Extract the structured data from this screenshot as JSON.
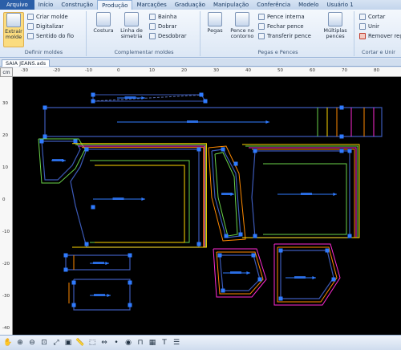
{
  "tabs": [
    "Arquivo",
    "Início",
    "Construção",
    "Produção",
    "Marcações",
    "Graduação",
    "Manipulação",
    "Conferência",
    "Modelo",
    "Usuário 1"
  ],
  "active_tab": "Produção",
  "ribbon": {
    "definir_moldes": {
      "label": "Definir moldes",
      "extrair": "Extrair\nmolde",
      "criar": "Criar molde",
      "digitalizar": "Digitalizar",
      "sentido": "Sentido do fio"
    },
    "complementar": {
      "label": "Complementar moldes",
      "costura": "Costura",
      "linha": "Linha de\nsimetria",
      "bainha": "Bainha",
      "dobrar": "Dobrar",
      "desdobrar": "Desdobrar"
    },
    "pegas": {
      "label": "Pegas e Pences",
      "pegas": "Pegas",
      "pence_contorno": "Pence no\ncontorno",
      "pence_interna": "Pence interna",
      "fechar": "Fechar pence",
      "transferir": "Transferir pence",
      "multiplas": "Múltiplas\npences"
    },
    "cortar": {
      "label": "Cortar e Unir",
      "cortar": "Cortar",
      "unir": "Unir",
      "remover": "Remover reg"
    }
  },
  "document_tab": "SAIA JEANS.ads",
  "ruler_unit": "cm",
  "hruler_ticks": [
    "-30",
    "-20",
    "-10",
    "0",
    "10",
    "20",
    "30",
    "40",
    "50",
    "60",
    "70",
    "80"
  ],
  "vruler_ticks": [
    "30",
    "20",
    "10",
    "0",
    "-10",
    "-20",
    "-30",
    "-40"
  ],
  "pattern_colors": {
    "outline": "#3c5ab8",
    "size1": "#ff8a00",
    "size2": "#ff2ad4",
    "size3": "#6ad24a",
    "size4": "#ffd800",
    "grain": "#2f7bff",
    "point": "#2f7bff"
  },
  "bottom_tools": [
    "hand-icon",
    "zoom-in-icon",
    "zoom-out-icon",
    "zoom-window-icon",
    "zoom-fit-icon",
    "zoom-page-icon",
    "ruler-icon",
    "select-icon",
    "measure-icon",
    "point-icon",
    "eye-icon",
    "magnet-icon",
    "grid-icon",
    "text-icon",
    "layers-icon"
  ]
}
